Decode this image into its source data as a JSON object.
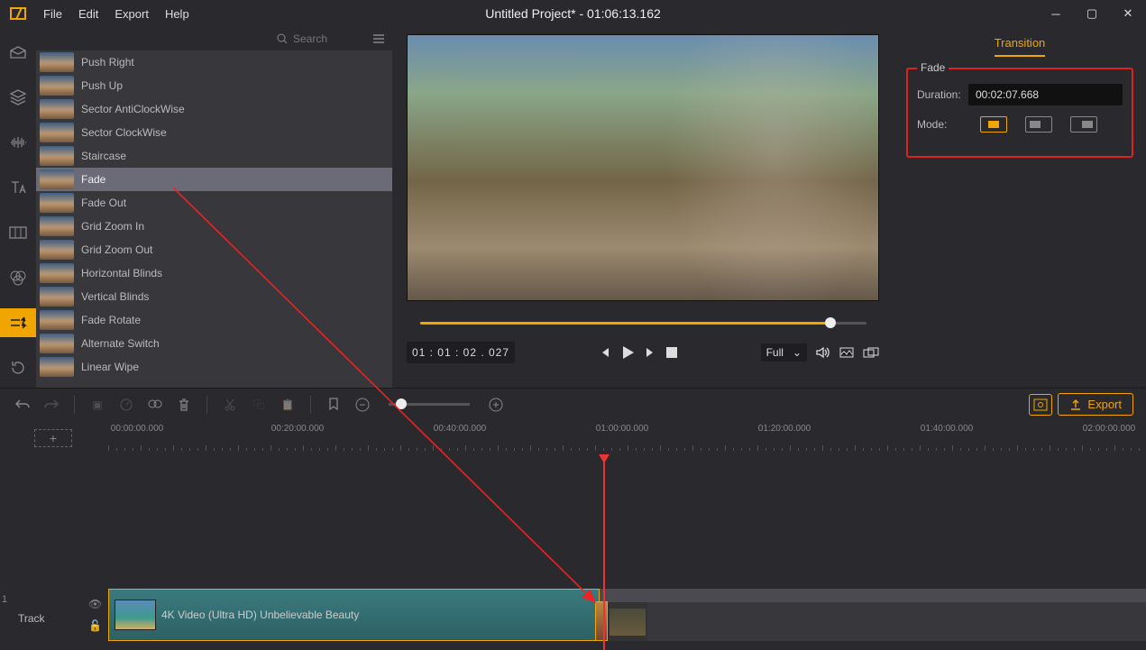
{
  "menu": {
    "file": "File",
    "edit": "Edit",
    "export": "Export",
    "help": "Help"
  },
  "title": "Untitled Project* - 01:06:13.162",
  "search": {
    "placeholder": "Search"
  },
  "rail": {
    "media": "media-icon",
    "layers": "layers-icon",
    "audio": "audio-icon",
    "text": "text-icon",
    "crop": "crop-icon",
    "color": "color-icon",
    "transition": "transition-icon",
    "rotate": "rotate-icon"
  },
  "transitions": [
    "Push Right",
    "Push Up",
    "Sector AntiClockWise",
    "Sector ClockWise",
    "Staircase",
    "Fade",
    "Fade Out",
    "Grid Zoom In",
    "Grid Zoom Out",
    "Horizontal Blinds",
    "Vertical Blinds",
    "Fade Rotate",
    "Alternate Switch",
    "Linear Wipe"
  ],
  "transitions_selected_index": 5,
  "preview": {
    "timecode": "01 : 01 : 02 . 027",
    "full_label": "Full"
  },
  "props": {
    "tab": "Transition",
    "group": "Fade",
    "duration_label": "Duration:",
    "duration_value": "00:02:07.668",
    "mode_label": "Mode:"
  },
  "toolbar": {
    "export": "Export"
  },
  "ruler": {
    "labels": [
      "00:00:00.000",
      "00:20:00.000",
      "00:40:00.000",
      "01:00:00.000",
      "01:20:00.000",
      "01:40:00.000",
      "02:00:00.000"
    ]
  },
  "timeline": {
    "track_number": "1",
    "track_label": "Track",
    "add_track": "+",
    "clip_title": "4K Video (Ultra HD) Unbelievable Beauty"
  }
}
